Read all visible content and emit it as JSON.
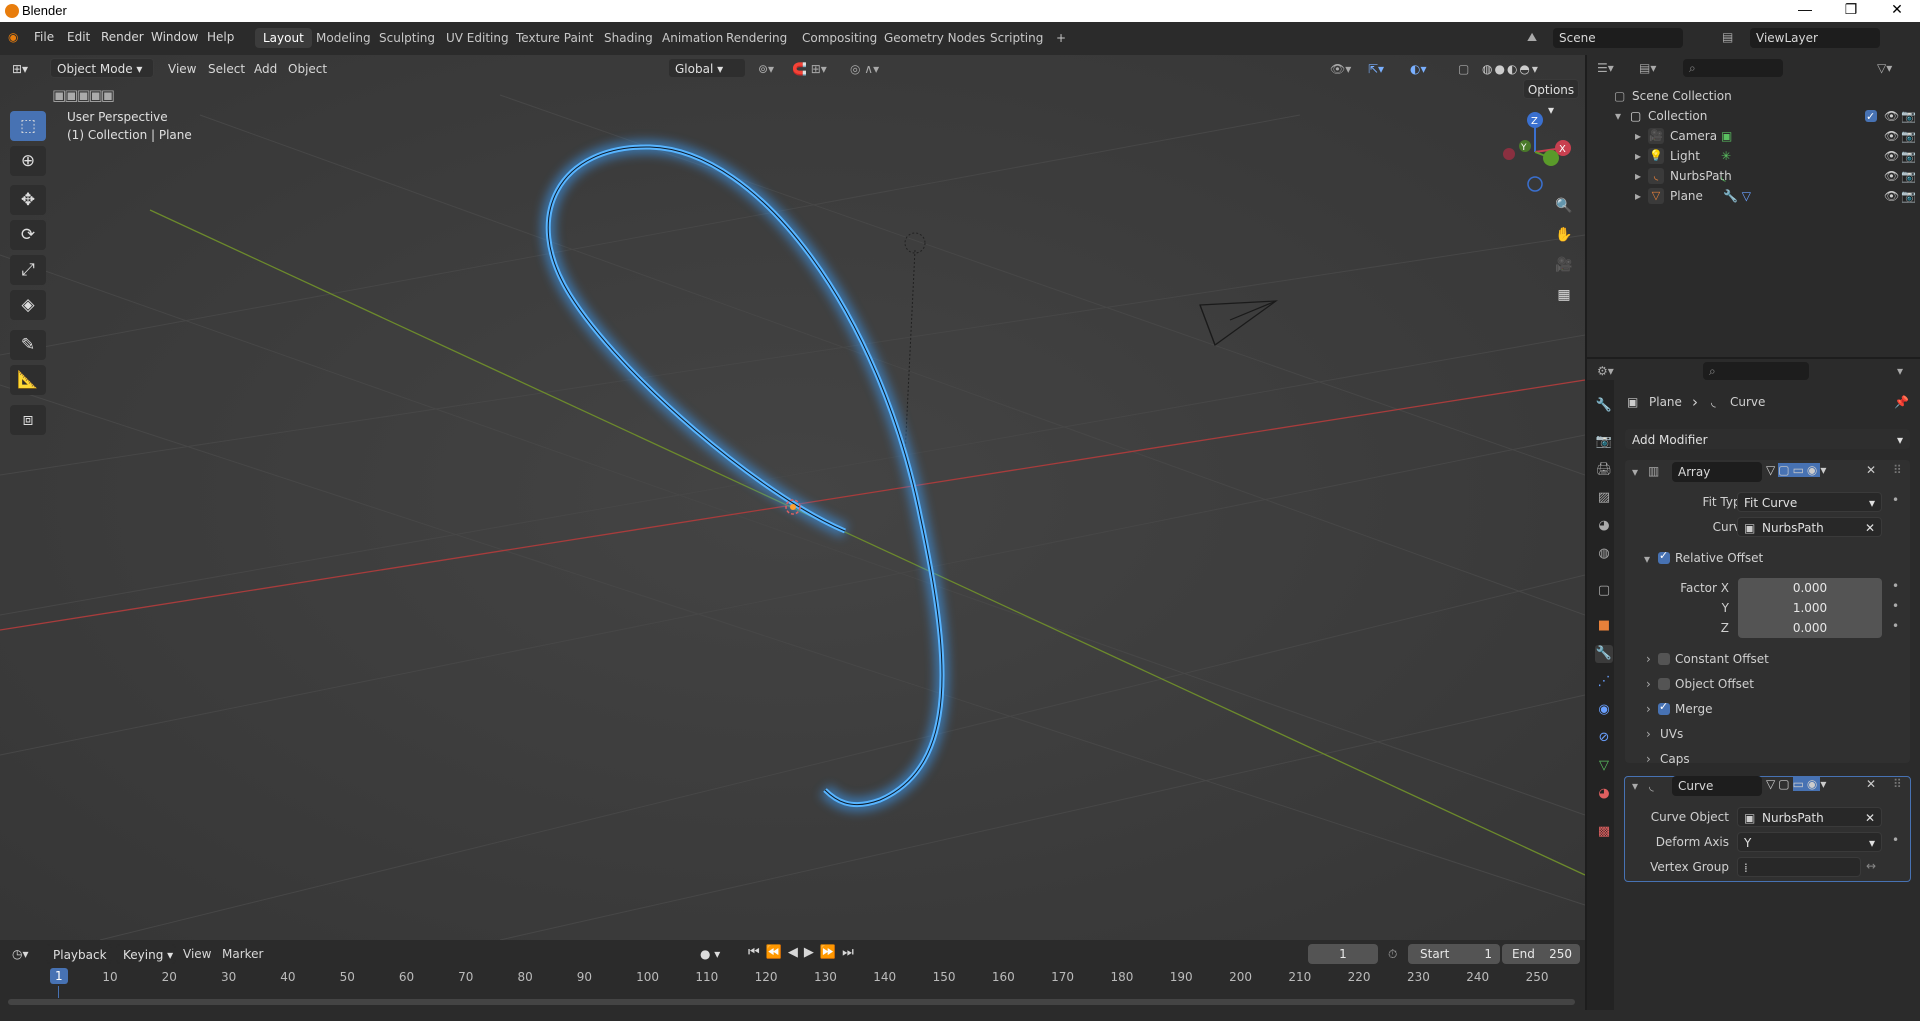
{
  "window": {
    "title": "Blender",
    "min": "—",
    "max": "❐",
    "close": "✕"
  },
  "menu": {
    "file": "File",
    "edit": "Edit",
    "render": "Render",
    "window": "Window",
    "help": "Help"
  },
  "workspaces": [
    "Layout",
    "Modeling",
    "Sculpting",
    "UV Editing",
    "Texture Paint",
    "Shading",
    "Animation",
    "Rendering",
    "Compositing",
    "Geometry Nodes",
    "Scripting"
  ],
  "workspace_add": "+",
  "scene": {
    "name": "Scene",
    "view_layer": "ViewLayer"
  },
  "viewport": {
    "mode": "Object Mode",
    "view": "View",
    "select": "Select",
    "add": "Add",
    "object": "Object",
    "orientation": "Global",
    "options": "Options",
    "info_line1": "User Perspective",
    "info_line2": "(1) Collection | Plane",
    "gizmo": {
      "z": "Z",
      "x": "X",
      "y": "Y"
    }
  },
  "outliner": {
    "root": "Scene Collection",
    "collection": "Collection",
    "items": [
      {
        "name": "Camera",
        "icon": "camera-icon"
      },
      {
        "name": "Light",
        "icon": "light-icon"
      },
      {
        "name": "NurbsPath",
        "icon": "curve-icon"
      },
      {
        "name": "Plane",
        "icon": "mesh-icon"
      }
    ]
  },
  "properties": {
    "breadcrumb_object": "Plane",
    "breadcrumb_sep": "›",
    "breadcrumb_data": "Curve",
    "add_modifier": "Add Modifier",
    "array": {
      "name": "Array",
      "fit_type_label": "Fit Type",
      "fit_type": "Fit Curve",
      "curve_label": "Curve",
      "curve": "NurbsPath",
      "relative_offset": "Relative Offset",
      "factor_x_label": "Factor X",
      "factor_x": "0.000",
      "y_label": "Y",
      "y": "1.000",
      "z_label": "Z",
      "z": "0.000",
      "constant_offset": "Constant Offset",
      "object_offset": "Object Offset",
      "merge": "Merge",
      "uvs": "UVs",
      "caps": "Caps"
    },
    "curve_mod": {
      "name": "Curve",
      "object_label": "Curve Object",
      "object": "NurbsPath",
      "deform_axis_label": "Deform Axis",
      "deform_axis": "Y",
      "vertex_group_label": "Vertex Group",
      "vertex_group": ""
    }
  },
  "timeline": {
    "playback": "Playback",
    "keying": "Keying",
    "view": "View",
    "marker": "Marker",
    "current_frame": "1",
    "start_label": "Start",
    "start": "1",
    "end_label": "End",
    "end": "250",
    "ticks": [
      "1",
      "10",
      "20",
      "30",
      "40",
      "50",
      "60",
      "70",
      "80",
      "90",
      "100",
      "110",
      "120",
      "130",
      "140",
      "150",
      "160",
      "170",
      "180",
      "190",
      "200",
      "210",
      "220",
      "230",
      "240",
      "250"
    ]
  },
  "colors": {
    "accent": "#4772b3",
    "curve_glow": "#3aa0ff",
    "x_axis": "#b03a3a",
    "y_axis": "#6b8a2a"
  }
}
